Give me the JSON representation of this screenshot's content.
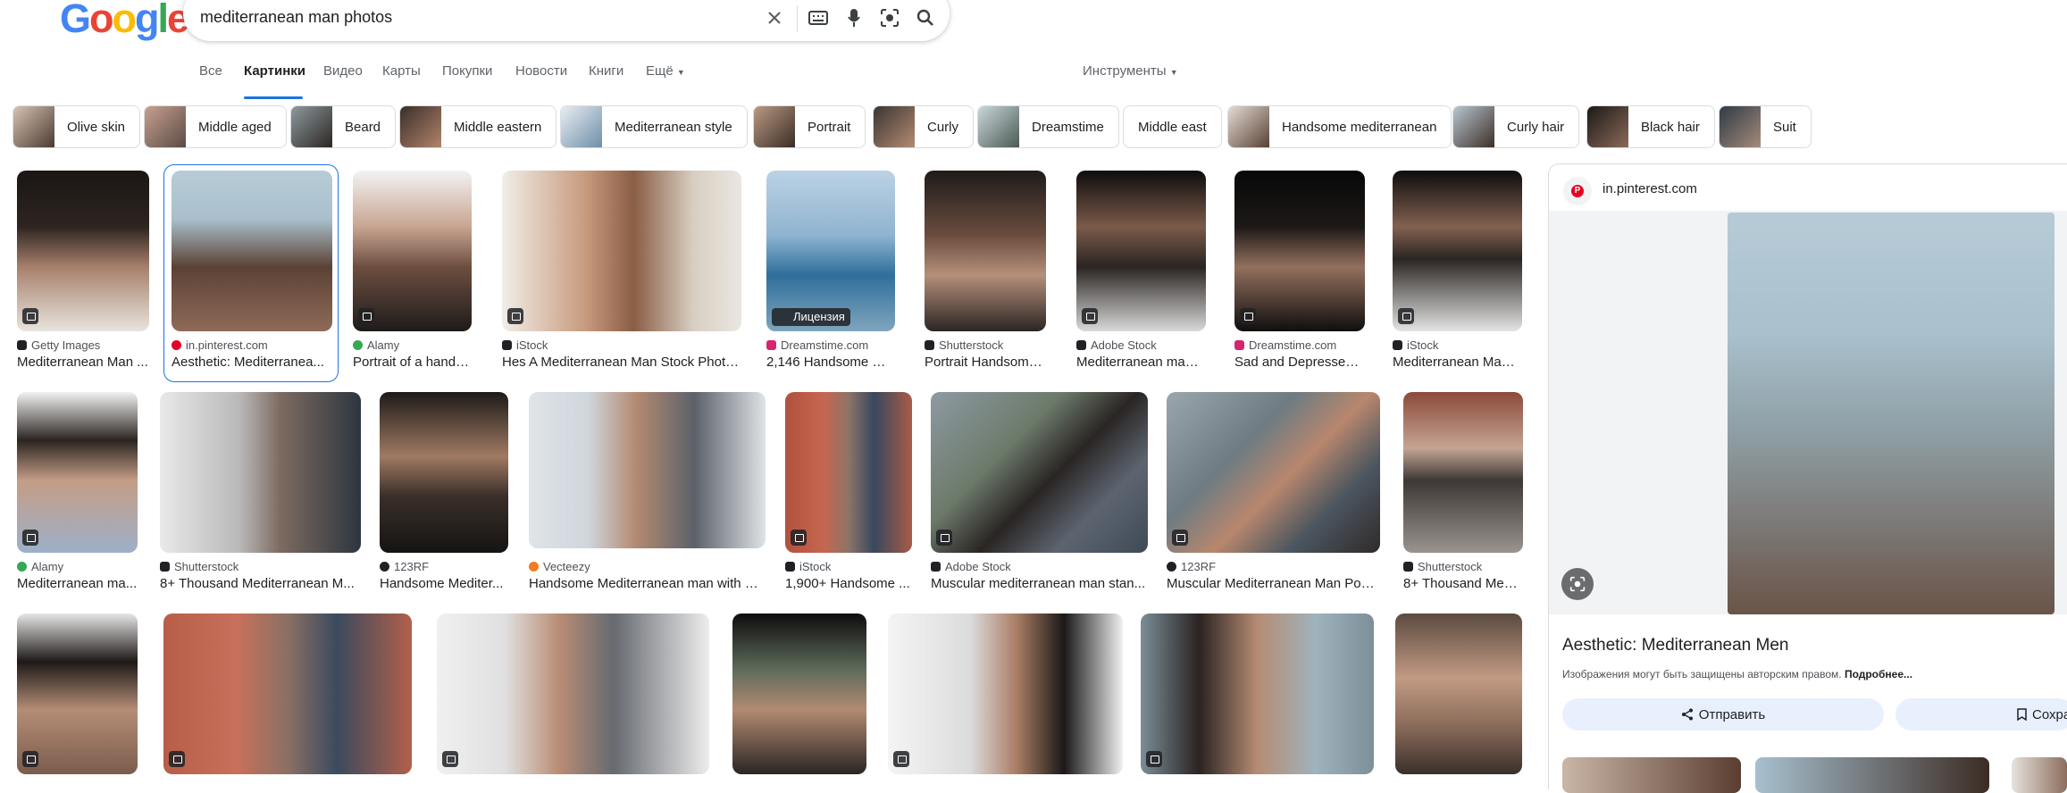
{
  "search": {
    "query": "mediterranean man photos"
  },
  "logo": {
    "text": "Google"
  },
  "tabs": [
    "Все",
    "Картинки",
    "Видео",
    "Карты",
    "Покупки",
    "Новости",
    "Книги",
    "Ещё"
  ],
  "tools_label": "Инструменты",
  "chips": [
    "Olive skin",
    "Middle aged",
    "Beard",
    "Middle eastern",
    "Mediterranean style",
    "Portrait",
    "Curly",
    "Dreamstime",
    "Middle east",
    "Handsome mediterranean",
    "Curly hair",
    "Black hair",
    "Suit"
  ],
  "results_row1": [
    {
      "source": "Getty Images",
      "title": "Mediterranean Man ..."
    },
    {
      "source": "in.pinterest.com",
      "title": "Aesthetic: Mediterranea..."
    },
    {
      "source": "Alamy",
      "title": "Portrait of a hands..."
    },
    {
      "source": "iStock",
      "title": "Hes A Mediterranean Man Stock Photo..."
    },
    {
      "source": "Dreamstime.com",
      "title": "2,146 Handsome Me..."
    },
    {
      "source": "Shutterstock",
      "title": "Portrait Handsome ..."
    },
    {
      "source": "Adobe Stock",
      "title": "Mediterranean man ..."
    },
    {
      "source": "Dreamstime.com",
      "title": "Sad and Depressed ..."
    },
    {
      "source": "iStock",
      "title": "Mediterranean Man ..."
    }
  ],
  "results_row2": [
    {
      "source": "Alamy",
      "title": "Mediterranean ma..."
    },
    {
      "source": "Shutterstock",
      "title": "8+ Thousand Mediterranean M..."
    },
    {
      "source": "123RF",
      "title": "Handsome Mediter..."
    },
    {
      "source": "Vecteezy",
      "title": "Handsome Mediterranean man with ol..."
    },
    {
      "source": "iStock",
      "title": "1,900+ Handsome ..."
    },
    {
      "source": "Adobe Stock",
      "title": "Muscular mediterranean man stan..."
    },
    {
      "source": "123RF",
      "title": "Muscular Mediterranean Man Posi..."
    },
    {
      "source": "Shutterstock",
      "title": "8+ Thousand Medi..."
    }
  ],
  "license_label": "Лицензия",
  "panel": {
    "source": "in.pinterest.com",
    "title": "Aesthetic: Mediterranean Men",
    "copyright_text": "Изображения могут быть защищены авторским правом.",
    "more_link": "Подробнее...",
    "share_label": "Отправить",
    "save_label": "Сохра"
  },
  "colors": {
    "accent": "#1a73e8",
    "pinterest": "#e60023"
  }
}
